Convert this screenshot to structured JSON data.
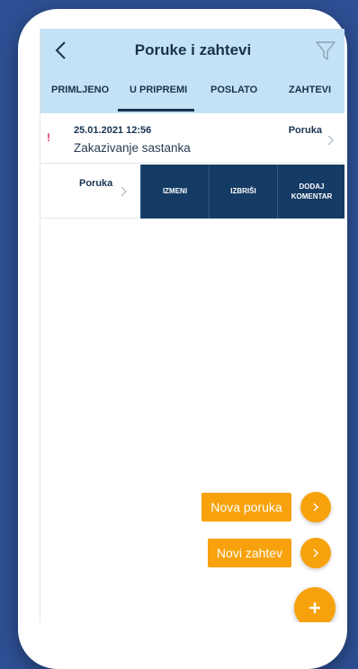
{
  "header": {
    "title": "Poruke i zahtevi",
    "back_icon": "chevron-left-icon",
    "filter_icon": "filter-icon"
  },
  "tabs": [
    {
      "label": "PRIMLJENO",
      "active": false
    },
    {
      "label": "U PRIPREMI",
      "active": true
    },
    {
      "label": "POSLATO",
      "active": false
    },
    {
      "label": "ZAHTEVI",
      "active": false
    }
  ],
  "messages": [
    {
      "priority_mark": "!",
      "date": "25.01.2021 12:56",
      "subject": "Zakazivanje sastanka",
      "type": "Poruka"
    }
  ],
  "swiped_row": {
    "type": "Poruka",
    "actions": {
      "edit": "IZMENI",
      "delete": "IZBRIŠI",
      "comment_line1": "DODAJ",
      "comment_line2": "KOMENTAR"
    }
  },
  "fab": {
    "new_message": "Nova poruka",
    "new_request": "Novi zahtev",
    "main_icon": "plus-icon"
  },
  "colors": {
    "background": "#2d4f93",
    "header": "#c4e2f5",
    "navy": "#143b63",
    "accent_orange": "#f7a20c",
    "alert": "#e0306b"
  }
}
